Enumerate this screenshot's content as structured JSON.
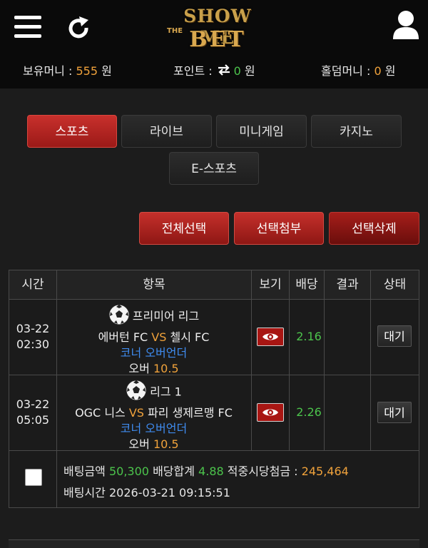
{
  "header": {
    "logo": {
      "line1": "SHOW ME",
      "small": "THE",
      "line2": "BET"
    },
    "icons": {
      "menu": "menu-icon",
      "refresh": "refresh-icon",
      "user": "user-icon"
    }
  },
  "balances": {
    "holding_label": "보유머니 :",
    "holding_value": "555",
    "holding_unit": "원",
    "point_label": "포인트 :",
    "point_value": "0",
    "point_unit": "원",
    "holdem_label": "홀덤머니 :",
    "holdem_value": "0",
    "holdem_unit": "원"
  },
  "tabs": [
    {
      "label": "스포츠",
      "active": true
    },
    {
      "label": "라이브",
      "active": false
    },
    {
      "label": "미니게임",
      "active": false
    },
    {
      "label": "카지노",
      "active": false
    },
    {
      "label": "E-스포츠",
      "active": false
    }
  ],
  "actions": {
    "select_all": "전체선택",
    "attach": "선택첨부",
    "delete": "선택삭제"
  },
  "table": {
    "headers": [
      "시간",
      "항목",
      "보기",
      "배당",
      "결과",
      "상태"
    ],
    "rows": [
      {
        "date": "03-22",
        "time": "02:30",
        "league": "프리미어 리그",
        "home": "에버턴 FC",
        "vs": "VS",
        "away": "첼시 FC",
        "market": "코너 오버언더",
        "pick": "오버",
        "line": "10.5",
        "odds": "2.16",
        "result": "",
        "status": "대기"
      },
      {
        "date": "03-22",
        "time": "05:05",
        "league": "리그 1",
        "home": "OGC 니스",
        "vs": "VS",
        "away": "파리 생제르맹 FC",
        "market": "코너 오버언더",
        "pick": "오버",
        "line": "10.5",
        "odds": "2.26",
        "result": "",
        "status": "대기"
      }
    ],
    "summary": {
      "amount_label": "배팅금액",
      "amount_value": "50,300",
      "total_odds_label": "배당합계",
      "total_odds_value": "4.88",
      "payout_label": "적중시당첨금 :",
      "payout_value": "245,464",
      "time_label": "배팅시간",
      "time_value": "2026-03-21 09:15:51"
    }
  },
  "colors": {
    "accent_red": "#c8302c",
    "orange": "#f0a23b",
    "green": "#4cc44c",
    "blue": "#3f8cf0"
  }
}
